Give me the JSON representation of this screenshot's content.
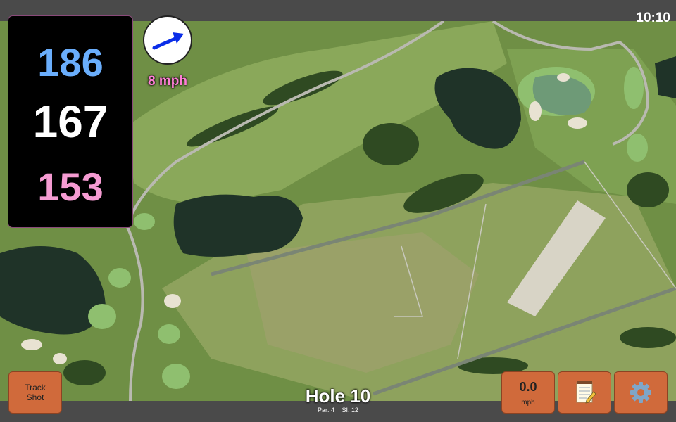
{
  "status": {
    "time": "10:10"
  },
  "distances": {
    "back": "186",
    "middle": "167",
    "front": "153",
    "colors": {
      "back": "#6aaefc",
      "middle": "#ffffff",
      "front": "#f59bd2"
    }
  },
  "wind": {
    "speed_label": "8 mph",
    "icon": "wind-direction-arrow-icon"
  },
  "buttons": {
    "track_shot_line1": "Track",
    "track_shot_line2": "Shot",
    "wind_value": "0.0",
    "wind_unit": "mph",
    "notes_icon": "notepad-icon",
    "settings_icon": "gear-icon"
  },
  "hole": {
    "title": "Hole 10",
    "par": "Par: 4",
    "stroke_index": "SI: 12"
  },
  "theme": {
    "button_color": "#d06a3b",
    "accent_pink": "#ff7fd6"
  }
}
